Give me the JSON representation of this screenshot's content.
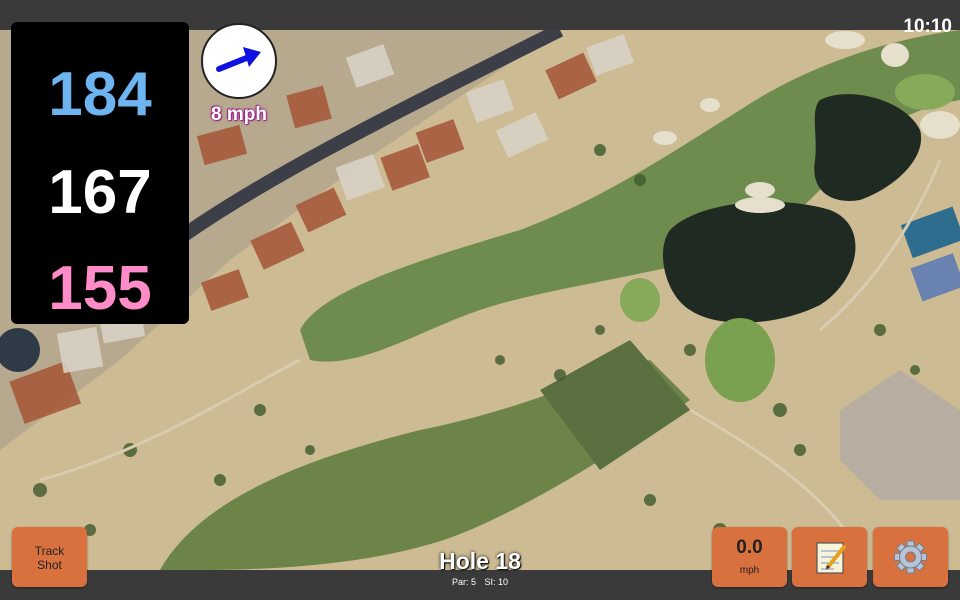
{
  "status": {
    "time": "10:10"
  },
  "distances": {
    "back": "184",
    "center": "167",
    "front": "155"
  },
  "wind": {
    "speed": "8 mph",
    "arrow_icon": "arrow-right-icon"
  },
  "buttons": {
    "track_shot_line1": "Track",
    "track_shot_line2": "Shot",
    "speed_value": "0.0",
    "speed_unit": "mph",
    "notes_icon": "notepad-icon",
    "settings_icon": "gear-icon"
  },
  "hole": {
    "title": "Hole 18",
    "par": "Par: 5",
    "si": "SI: 10"
  },
  "colors": {
    "back_distance": "#6eb4f0",
    "center_distance": "#ffffff",
    "front_distance": "#ff8cc8",
    "button": "#d9713f",
    "wind_label_outline": "#9b2a86"
  }
}
